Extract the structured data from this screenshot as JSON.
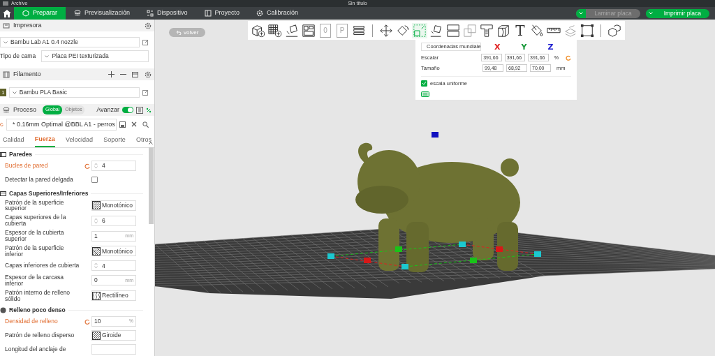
{
  "title_bar": {
    "menu": "Archivo",
    "title": "Sin título"
  },
  "main_tabs": [
    {
      "label": "Preparar",
      "selected": true
    },
    {
      "label": "Previsualización",
      "selected": false
    },
    {
      "label": "Dispositivo",
      "selected": false
    },
    {
      "label": "Proyecto",
      "selected": false
    },
    {
      "label": "Calibración",
      "selected": false
    }
  ],
  "actions": [
    {
      "label": "Laminar placa",
      "disabled": true
    },
    {
      "label": "Imprimir placa",
      "disabled": false
    }
  ],
  "printer": {
    "title": "Impresora",
    "preset": "Bambu Lab A1 0.4 nozzle",
    "bed_label": "Tipo de cama",
    "bed_value": "Placa PEI texturizada"
  },
  "filament": {
    "title": "Filamento",
    "slot": "1",
    "color": "#5f6128",
    "preset": "Bambu PLA Basic"
  },
  "process": {
    "title": "Proceso",
    "scopes": [
      {
        "label": "Global",
        "selected": true
      },
      {
        "label": "Objetos",
        "selected": false
      }
    ],
    "advanced_label": "Avanzar",
    "advanced_on": true,
    "preset": "* 0.16mm Optimal @BBL A1 - perros"
  },
  "setting_tabs": [
    {
      "label": "Calidad",
      "selected": false
    },
    {
      "label": "Fuerza",
      "selected": true
    },
    {
      "label": "Velocidad",
      "selected": false
    },
    {
      "label": "Soporte",
      "selected": false
    },
    {
      "label": "Otros",
      "selected": false
    }
  ],
  "groups": [
    {
      "title": "Paredes",
      "rows": [
        {
          "label": "Bucles de pared",
          "kind": "spin",
          "value": "4",
          "modified": true
        },
        {
          "label": "Detectar la pared delgada",
          "kind": "check",
          "checked": false,
          "modified": false
        }
      ]
    },
    {
      "title": "Capas Superiores/Inferiores",
      "rows": [
        {
          "label": "Patrón de la superficie superior",
          "kind": "pattern",
          "value": "Monotónico",
          "modified": false
        },
        {
          "label": "Capas superiores de la cubierta",
          "kind": "spin",
          "value": "6",
          "modified": false
        },
        {
          "label": "Espesor de la cubierta superior",
          "kind": "number",
          "value": "1",
          "unit": "mm",
          "modified": false
        },
        {
          "label": "Patrón de la superficie inferior",
          "kind": "pattern",
          "value": "Monotónico",
          "modified": false
        },
        {
          "label": "Capas inferiores de cubierta",
          "kind": "spin",
          "value": "4",
          "modified": false
        },
        {
          "label": "Espesor de la carcasa inferior",
          "kind": "number",
          "value": "0",
          "unit": "mm",
          "modified": false
        },
        {
          "label": "Patrón interno de relleno sólido",
          "kind": "pattern",
          "value": "Rectilíneo",
          "modified": false
        }
      ]
    },
    {
      "title": "Relleno poco denso",
      "rows": [
        {
          "label": "Densidad de relleno",
          "kind": "number",
          "value": "10",
          "unit": "%",
          "modified": true
        },
        {
          "label": "Patrón de relleno disperso",
          "kind": "pattern",
          "value": "Giroide",
          "modified": false
        },
        {
          "label": "Longitud del anclaje de",
          "kind": "number",
          "modified": false
        }
      ]
    }
  ],
  "viewport": {
    "back": "volver",
    "toolbar": [
      {
        "kind": "addcube",
        "disabled": false,
        "selected": false
      },
      {
        "kind": "addplate",
        "disabled": false,
        "selected": false
      },
      {
        "kind": "auto",
        "disabled": false,
        "selected": false
      },
      {
        "kind": "arrange",
        "disabled": false,
        "selected": false
      },
      {
        "kind": "page",
        "glyph": "0",
        "disabled": true,
        "selected": false
      },
      {
        "kind": "page",
        "glyph": "P",
        "disabled": true,
        "selected": false
      },
      {
        "kind": "layers",
        "disabled": false,
        "selected": false
      },
      {
        "kind": "separator"
      },
      {
        "kind": "move",
        "disabled": false,
        "selected": false
      },
      {
        "kind": "rotate",
        "disabled": false,
        "selected": false
      },
      {
        "kind": "scale",
        "disabled": false,
        "selected": true
      },
      {
        "kind": "flatten",
        "disabled": false,
        "selected": false
      },
      {
        "kind": "split",
        "disabled": false,
        "selected": false
      },
      {
        "kind": "boolean",
        "disabled": true,
        "selected": false
      },
      {
        "kind": "support",
        "disabled": false,
        "selected": false
      },
      {
        "kind": "cut",
        "disabled": false,
        "selected": false
      },
      {
        "kind": "text",
        "glyph": "T",
        "disabled": false,
        "selected": false
      },
      {
        "kind": "paint",
        "disabled": false,
        "selected": false
      },
      {
        "kind": "measure",
        "disabled": false,
        "selected": false
      },
      {
        "kind": "assembly",
        "disabled": true,
        "selected": false
      },
      {
        "kind": "frame",
        "disabled": false,
        "selected": false
      },
      {
        "kind": "separator"
      },
      {
        "kind": "view",
        "disabled": false,
        "selected": false
      }
    ],
    "scale_panel": {
      "coords": "Coordenadas mundiale",
      "axes": [
        {
          "label": "X",
          "color": "#e02020"
        },
        {
          "label": "Y",
          "color": "#1c9a3c"
        },
        {
          "label": "Z",
          "color": "#2020d0"
        }
      ],
      "rows": [
        {
          "label": "Escalar",
          "values": [
            "391,66",
            "391,66",
            "391,66"
          ],
          "unit": "%",
          "reset": true
        },
        {
          "label": "Tamaño",
          "values": [
            "99,48",
            "68,92",
            "70,00"
          ],
          "unit": "mm",
          "reset": false
        }
      ],
      "uniform_label": "escala uniforme",
      "uniform_checked": true
    }
  }
}
